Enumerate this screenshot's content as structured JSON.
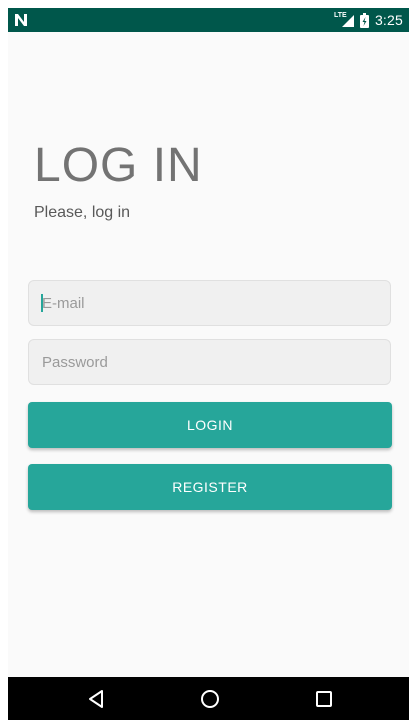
{
  "status_bar": {
    "background": "#00574b",
    "notification_icon": "n-notification-icon",
    "network_label": "LTE",
    "time": "3:25"
  },
  "page": {
    "title": "LOG IN",
    "subtitle": "Please, log in"
  },
  "form": {
    "email": {
      "placeholder": "E-mail",
      "value": ""
    },
    "password": {
      "placeholder": "Password",
      "value": ""
    },
    "login_label": "LOGIN",
    "register_label": "REGISTER"
  },
  "colors": {
    "accent": "#26a69a",
    "status_bar": "#00574b",
    "background": "#fafafa",
    "nav_bar": "#000000"
  },
  "nav_bar": {
    "items": [
      "back-icon",
      "home-icon",
      "recents-icon"
    ]
  }
}
